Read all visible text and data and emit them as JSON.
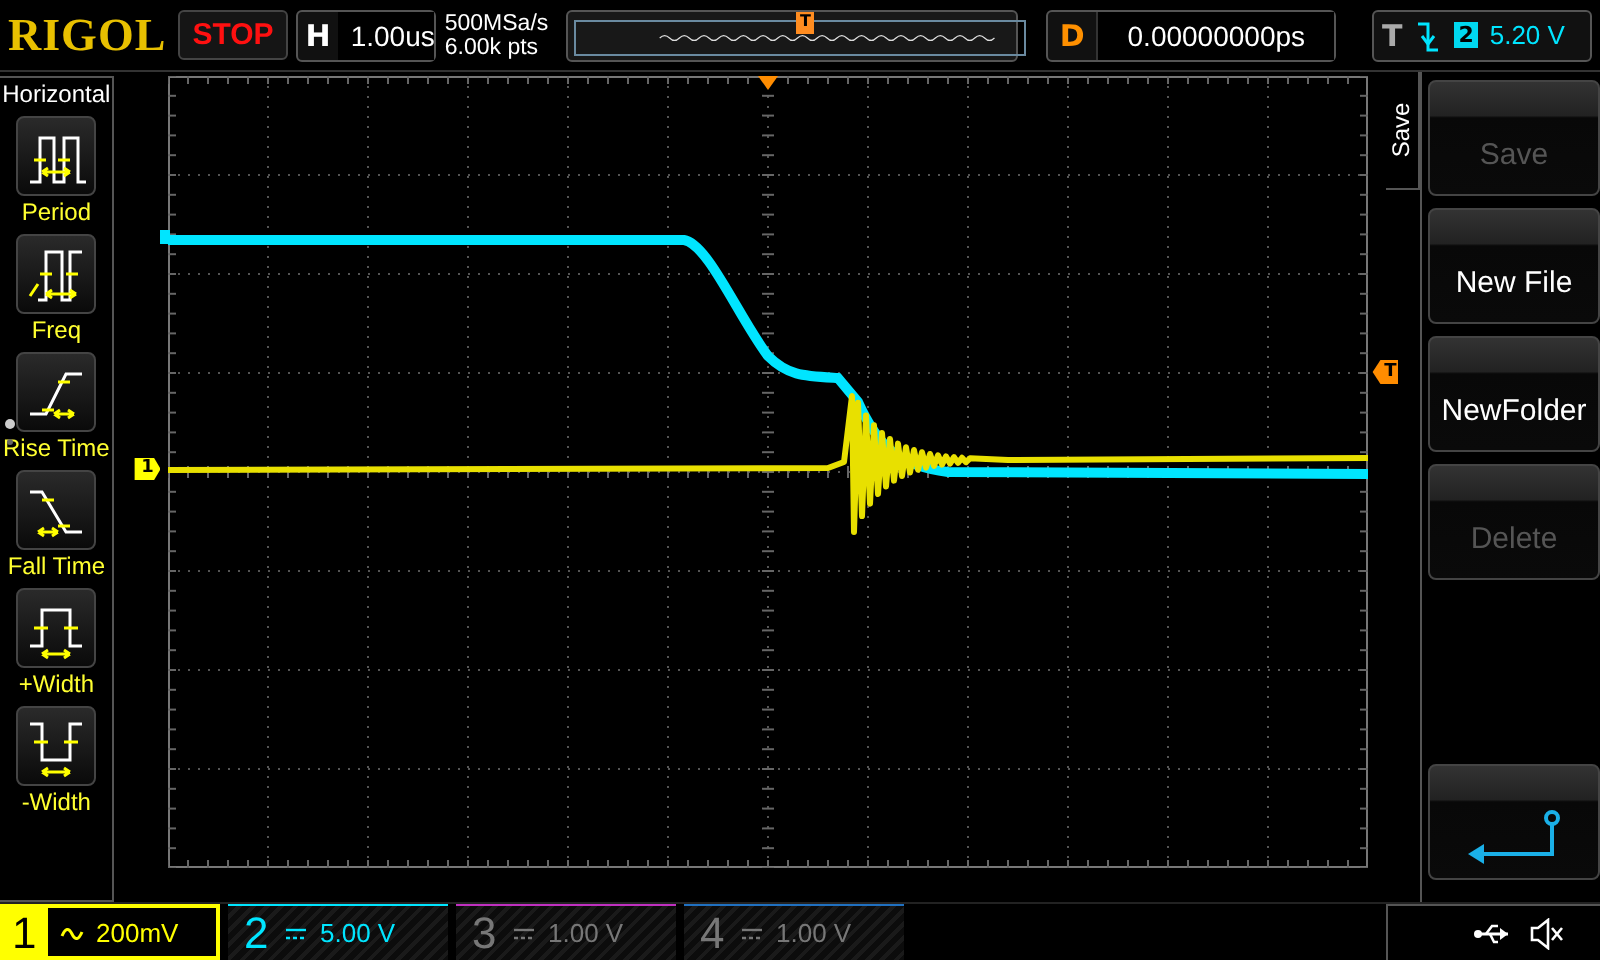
{
  "brand": "RIGOL",
  "run_state": {
    "label": "STOP",
    "running": false
  },
  "timebase": {
    "label": "H",
    "scale": "1.00us"
  },
  "acquisition": {
    "sample_rate": "500MSa/s",
    "memory_depth": "6.00k pts"
  },
  "delay": {
    "label": "D",
    "value": "0.00000000ps"
  },
  "overview_marker": {
    "label": "T"
  },
  "trigger": {
    "label": "T",
    "source": "2",
    "trigger_level": "5.20 V"
  },
  "measure_menu": {
    "title": "Horizontal",
    "items": [
      {
        "label": "Period",
        "kind": "period"
      },
      {
        "label": "Freq",
        "kind": "freq"
      },
      {
        "label": "Rise Time",
        "kind": "rise"
      },
      {
        "label": "Fall Time",
        "kind": "fall"
      },
      {
        "label": "+Width",
        "kind": "pwidth"
      },
      {
        "label": "-Width",
        "kind": "nwidth"
      }
    ]
  },
  "side_menu": {
    "title": "Save",
    "buttons": [
      {
        "kind": "text",
        "label": "Save",
        "disabled": true
      },
      {
        "kind": "text",
        "label": "New File",
        "disabled": false
      },
      {
        "kind": "text",
        "label": "NewFolder",
        "disabled": false
      },
      {
        "kind": "text",
        "label": "Delete",
        "disabled": true
      },
      {
        "kind": "return"
      }
    ]
  },
  "channel_marker": {
    "label": "1"
  },
  "trigger_marker": {
    "label": "T"
  },
  "channels": [
    {
      "number": "1",
      "kind": "ac",
      "scale": "200mV",
      "on": true,
      "selected": true,
      "color": "#ffff00"
    },
    {
      "number": "2",
      "kind": "dc",
      "scale": "5.00 V",
      "on": true,
      "selected": false,
      "color": "#00e5ff"
    },
    {
      "number": "3",
      "kind": "dc",
      "scale": "1.00 V",
      "on": false,
      "selected": false,
      "color": "#c030c0"
    },
    {
      "number": "4",
      "kind": "dc",
      "scale": "1.00 V",
      "on": false,
      "selected": false,
      "color": "#2070c0"
    }
  ]
}
